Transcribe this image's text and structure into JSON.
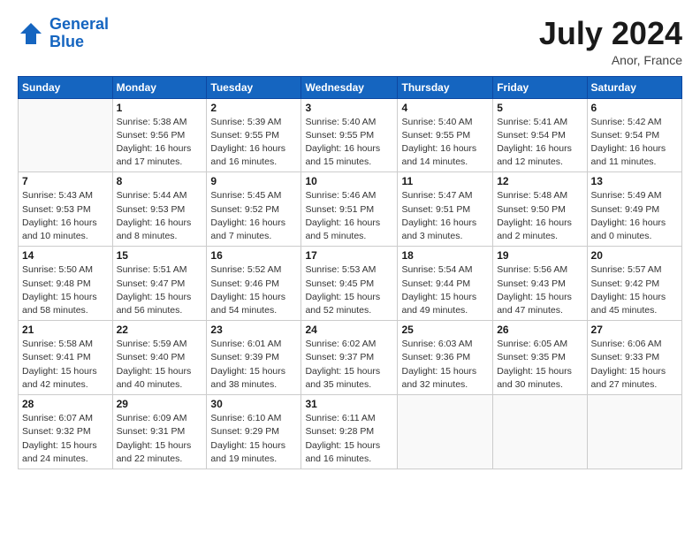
{
  "header": {
    "logo_line1": "General",
    "logo_line2": "Blue",
    "month": "July 2024",
    "location": "Anor, France"
  },
  "weekdays": [
    "Sunday",
    "Monday",
    "Tuesday",
    "Wednesday",
    "Thursday",
    "Friday",
    "Saturday"
  ],
  "weeks": [
    [
      {
        "day": "",
        "info": ""
      },
      {
        "day": "1",
        "info": "Sunrise: 5:38 AM\nSunset: 9:56 PM\nDaylight: 16 hours\nand 17 minutes."
      },
      {
        "day": "2",
        "info": "Sunrise: 5:39 AM\nSunset: 9:55 PM\nDaylight: 16 hours\nand 16 minutes."
      },
      {
        "day": "3",
        "info": "Sunrise: 5:40 AM\nSunset: 9:55 PM\nDaylight: 16 hours\nand 15 minutes."
      },
      {
        "day": "4",
        "info": "Sunrise: 5:40 AM\nSunset: 9:55 PM\nDaylight: 16 hours\nand 14 minutes."
      },
      {
        "day": "5",
        "info": "Sunrise: 5:41 AM\nSunset: 9:54 PM\nDaylight: 16 hours\nand 12 minutes."
      },
      {
        "day": "6",
        "info": "Sunrise: 5:42 AM\nSunset: 9:54 PM\nDaylight: 16 hours\nand 11 minutes."
      }
    ],
    [
      {
        "day": "7",
        "info": "Sunrise: 5:43 AM\nSunset: 9:53 PM\nDaylight: 16 hours\nand 10 minutes."
      },
      {
        "day": "8",
        "info": "Sunrise: 5:44 AM\nSunset: 9:53 PM\nDaylight: 16 hours\nand 8 minutes."
      },
      {
        "day": "9",
        "info": "Sunrise: 5:45 AM\nSunset: 9:52 PM\nDaylight: 16 hours\nand 7 minutes."
      },
      {
        "day": "10",
        "info": "Sunrise: 5:46 AM\nSunset: 9:51 PM\nDaylight: 16 hours\nand 5 minutes."
      },
      {
        "day": "11",
        "info": "Sunrise: 5:47 AM\nSunset: 9:51 PM\nDaylight: 16 hours\nand 3 minutes."
      },
      {
        "day": "12",
        "info": "Sunrise: 5:48 AM\nSunset: 9:50 PM\nDaylight: 16 hours\nand 2 minutes."
      },
      {
        "day": "13",
        "info": "Sunrise: 5:49 AM\nSunset: 9:49 PM\nDaylight: 16 hours\nand 0 minutes."
      }
    ],
    [
      {
        "day": "14",
        "info": "Sunrise: 5:50 AM\nSunset: 9:48 PM\nDaylight: 15 hours\nand 58 minutes."
      },
      {
        "day": "15",
        "info": "Sunrise: 5:51 AM\nSunset: 9:47 PM\nDaylight: 15 hours\nand 56 minutes."
      },
      {
        "day": "16",
        "info": "Sunrise: 5:52 AM\nSunset: 9:46 PM\nDaylight: 15 hours\nand 54 minutes."
      },
      {
        "day": "17",
        "info": "Sunrise: 5:53 AM\nSunset: 9:45 PM\nDaylight: 15 hours\nand 52 minutes."
      },
      {
        "day": "18",
        "info": "Sunrise: 5:54 AM\nSunset: 9:44 PM\nDaylight: 15 hours\nand 49 minutes."
      },
      {
        "day": "19",
        "info": "Sunrise: 5:56 AM\nSunset: 9:43 PM\nDaylight: 15 hours\nand 47 minutes."
      },
      {
        "day": "20",
        "info": "Sunrise: 5:57 AM\nSunset: 9:42 PM\nDaylight: 15 hours\nand 45 minutes."
      }
    ],
    [
      {
        "day": "21",
        "info": "Sunrise: 5:58 AM\nSunset: 9:41 PM\nDaylight: 15 hours\nand 42 minutes."
      },
      {
        "day": "22",
        "info": "Sunrise: 5:59 AM\nSunset: 9:40 PM\nDaylight: 15 hours\nand 40 minutes."
      },
      {
        "day": "23",
        "info": "Sunrise: 6:01 AM\nSunset: 9:39 PM\nDaylight: 15 hours\nand 38 minutes."
      },
      {
        "day": "24",
        "info": "Sunrise: 6:02 AM\nSunset: 9:37 PM\nDaylight: 15 hours\nand 35 minutes."
      },
      {
        "day": "25",
        "info": "Sunrise: 6:03 AM\nSunset: 9:36 PM\nDaylight: 15 hours\nand 32 minutes."
      },
      {
        "day": "26",
        "info": "Sunrise: 6:05 AM\nSunset: 9:35 PM\nDaylight: 15 hours\nand 30 minutes."
      },
      {
        "day": "27",
        "info": "Sunrise: 6:06 AM\nSunset: 9:33 PM\nDaylight: 15 hours\nand 27 minutes."
      }
    ],
    [
      {
        "day": "28",
        "info": "Sunrise: 6:07 AM\nSunset: 9:32 PM\nDaylight: 15 hours\nand 24 minutes."
      },
      {
        "day": "29",
        "info": "Sunrise: 6:09 AM\nSunset: 9:31 PM\nDaylight: 15 hours\nand 22 minutes."
      },
      {
        "day": "30",
        "info": "Sunrise: 6:10 AM\nSunset: 9:29 PM\nDaylight: 15 hours\nand 19 minutes."
      },
      {
        "day": "31",
        "info": "Sunrise: 6:11 AM\nSunset: 9:28 PM\nDaylight: 15 hours\nand 16 minutes."
      },
      {
        "day": "",
        "info": ""
      },
      {
        "day": "",
        "info": ""
      },
      {
        "day": "",
        "info": ""
      }
    ]
  ]
}
